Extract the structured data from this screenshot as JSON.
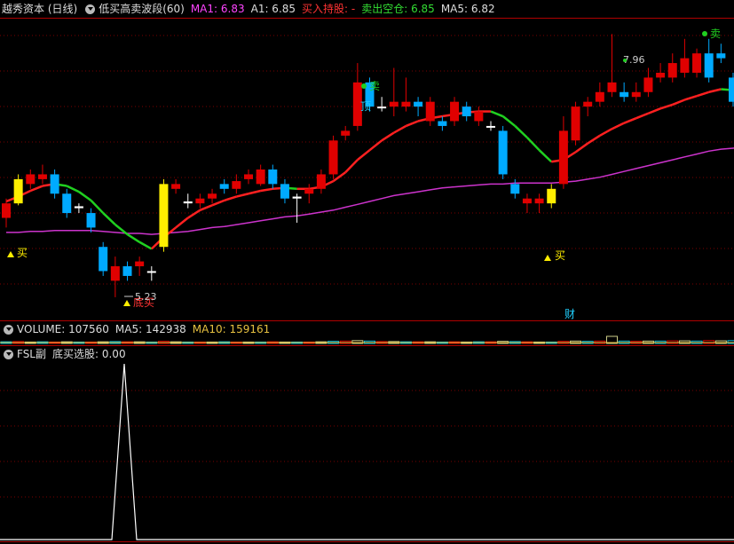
{
  "main_panel": {
    "title": "越秀资本 (日线)",
    "indicator": "低买高卖波段(60)",
    "ma1_label": "MA1: 6.83",
    "a1_label": "A1: 6.85",
    "buy_hold_label": "买入持股: -",
    "sell_empty_label": "卖出空仓: 6.85",
    "ma5_label": "MA5: 6.82",
    "colors": {
      "ma1": "#ff44ff",
      "a1": "#dddddd",
      "buy_hold": "#ff3333",
      "sell_empty": "#33dd33",
      "ma5": "#dddddd"
    },
    "annotations": {
      "buy": "买",
      "sell": "卖",
      "top": "顶",
      "bottom_buy": "底买",
      "wealth": "财",
      "low_price": "5.23",
      "high_price": "7.96"
    }
  },
  "volume_panel": {
    "label": "VOLUME: 107560",
    "ma5_label": "MA5: 142938",
    "ma10_label": "MA10: 159161"
  },
  "sub_panel": {
    "label": "FSL副",
    "signal_label": "底买选股: 0.00"
  },
  "chart_data": {
    "type": "candlestick",
    "candles": [
      [
        6.05,
        6.2,
        5.95,
        6.25
      ],
      [
        6.2,
        6.45,
        6.18,
        6.5
      ],
      [
        6.4,
        6.5,
        6.35,
        6.55
      ],
      [
        6.45,
        6.5,
        6.4,
        6.6
      ],
      [
        6.5,
        6.3,
        6.25,
        6.55
      ],
      [
        6.3,
        6.1,
        6.05,
        6.35
      ],
      [
        6.15,
        6.17,
        6.1,
        6.2
      ],
      [
        6.1,
        5.95,
        5.9,
        6.15
      ],
      [
        5.75,
        5.5,
        5.45,
        5.8
      ],
      [
        5.4,
        5.55,
        5.23,
        5.65
      ],
      [
        5.55,
        5.45,
        5.4,
        5.6
      ],
      [
        5.55,
        5.6,
        5.45,
        5.65
      ],
      [
        5.5,
        5.5,
        5.4,
        5.55
      ],
      [
        5.75,
        6.4,
        5.7,
        6.45
      ],
      [
        6.35,
        6.4,
        6.3,
        6.45
      ],
      [
        6.2,
        6.22,
        6.15,
        6.3
      ],
      [
        6.2,
        6.25,
        6.15,
        6.3
      ],
      [
        6.25,
        6.3,
        6.2,
        6.35
      ],
      [
        6.4,
        6.35,
        6.3,
        6.45
      ],
      [
        6.35,
        6.43,
        6.3,
        6.5
      ],
      [
        6.45,
        6.5,
        6.4,
        6.55
      ],
      [
        6.4,
        6.55,
        6.38,
        6.6
      ],
      [
        6.55,
        6.4,
        6.35,
        6.6
      ],
      [
        6.4,
        6.25,
        6.2,
        6.45
      ],
      [
        6.25,
        6.27,
        6.0,
        6.3
      ],
      [
        6.3,
        6.35,
        6.2,
        6.4
      ],
      [
        6.35,
        6.5,
        6.3,
        6.55
      ],
      [
        6.5,
        6.85,
        6.45,
        6.9
      ],
      [
        6.9,
        6.95,
        6.85,
        7.0
      ],
      [
        7.0,
        7.45,
        6.95,
        7.65
      ],
      [
        7.45,
        7.2,
        7.15,
        7.5
      ],
      [
        7.2,
        7.2,
        7.15,
        7.3
      ],
      [
        7.2,
        7.25,
        7.1,
        7.6
      ],
      [
        7.2,
        7.25,
        7.15,
        7.5
      ],
      [
        7.25,
        7.2,
        7.1,
        7.3
      ],
      [
        7.05,
        7.25,
        7.0,
        7.3
      ],
      [
        7.05,
        7.0,
        6.95,
        7.1
      ],
      [
        7.05,
        7.25,
        7.0,
        7.3
      ],
      [
        7.2,
        7.1,
        7.05,
        7.25
      ],
      [
        7.05,
        7.15,
        7.0,
        7.2
      ],
      [
        7.0,
        7.0,
        6.95,
        7.05
      ],
      [
        6.95,
        6.5,
        6.45,
        7.0
      ],
      [
        6.4,
        6.3,
        6.25,
        6.45
      ],
      [
        6.2,
        6.25,
        6.1,
        6.3
      ],
      [
        6.2,
        6.25,
        6.1,
        6.3
      ],
      [
        6.2,
        6.35,
        6.15,
        6.4
      ],
      [
        6.4,
        6.95,
        6.35,
        7.1
      ],
      [
        6.85,
        7.2,
        6.8,
        7.25
      ],
      [
        7.2,
        7.25,
        7.1,
        7.3
      ],
      [
        7.25,
        7.35,
        7.2,
        7.45
      ],
      [
        7.35,
        7.45,
        7.3,
        7.95
      ],
      [
        7.35,
        7.3,
        7.25,
        7.45
      ],
      [
        7.3,
        7.35,
        7.25,
        7.45
      ],
      [
        7.35,
        7.5,
        7.3,
        7.6
      ],
      [
        7.5,
        7.55,
        7.45,
        7.65
      ],
      [
        7.5,
        7.65,
        7.45,
        7.75
      ],
      [
        7.55,
        7.7,
        7.5,
        7.9
      ],
      [
        7.55,
        7.75,
        7.5,
        7.8
      ],
      [
        7.75,
        7.5,
        7.45,
        7.9
      ],
      [
        7.75,
        7.7,
        7.65,
        7.85
      ],
      [
        7.5,
        7.25,
        7.2,
        7.55
      ],
      [
        7.2,
        7.15,
        7.1,
        7.25
      ]
    ],
    "ma_short": [
      6.22,
      6.27,
      6.33,
      6.38,
      6.4,
      6.38,
      6.32,
      6.23,
      6.1,
      5.98,
      5.88,
      5.8,
      5.73,
      5.85,
      5.95,
      6.05,
      6.13,
      6.18,
      6.23,
      6.27,
      6.3,
      6.33,
      6.35,
      6.36,
      6.35,
      6.35,
      6.37,
      6.43,
      6.52,
      6.65,
      6.75,
      6.85,
      6.93,
      7.0,
      7.05,
      7.08,
      7.1,
      7.12,
      7.14,
      7.15,
      7.15,
      7.1,
      7.0,
      6.88,
      6.75,
      6.63,
      6.65,
      6.73,
      6.82,
      6.9,
      6.97,
      7.03,
      7.08,
      7.13,
      7.18,
      7.22,
      7.27,
      7.31,
      7.35,
      7.38,
      7.37,
      7.35
    ],
    "ma_long": [
      5.9,
      5.9,
      5.91,
      5.91,
      5.92,
      5.92,
      5.92,
      5.92,
      5.91,
      5.9,
      5.89,
      5.89,
      5.88,
      5.89,
      5.9,
      5.91,
      5.93,
      5.95,
      5.96,
      5.98,
      6.0,
      6.02,
      6.04,
      6.06,
      6.07,
      6.09,
      6.11,
      6.13,
      6.16,
      6.19,
      6.22,
      6.25,
      6.28,
      6.3,
      6.32,
      6.34,
      6.36,
      6.37,
      6.38,
      6.39,
      6.4,
      6.4,
      6.41,
      6.41,
      6.41,
      6.41,
      6.42,
      6.43,
      6.45,
      6.47,
      6.5,
      6.53,
      6.56,
      6.59,
      6.62,
      6.65,
      6.68,
      6.71,
      6.74,
      6.76,
      6.77,
      6.78
    ],
    "ylim": [
      5.0,
      8.1
    ],
    "volume": [
      0.35,
      0.4,
      0.3,
      0.35,
      0.3,
      0.35,
      0.3,
      0.3,
      0.35,
      0.4,
      0.35,
      0.35,
      0.3,
      0.45,
      0.35,
      0.3,
      0.3,
      0.3,
      0.35,
      0.3,
      0.3,
      0.3,
      0.35,
      0.3,
      0.3,
      0.3,
      0.35,
      0.45,
      0.5,
      0.6,
      0.5,
      0.4,
      0.4,
      0.35,
      0.35,
      0.35,
      0.3,
      0.35,
      0.3,
      0.35,
      0.35,
      0.45,
      0.4,
      0.35,
      0.3,
      0.3,
      0.45,
      0.5,
      0.45,
      0.5,
      1.5,
      0.5,
      0.45,
      0.5,
      0.5,
      0.55,
      0.55,
      0.5,
      0.6,
      0.55,
      0.6,
      0.6
    ],
    "signal": {
      "spike_index": 9,
      "value": 1
    }
  }
}
